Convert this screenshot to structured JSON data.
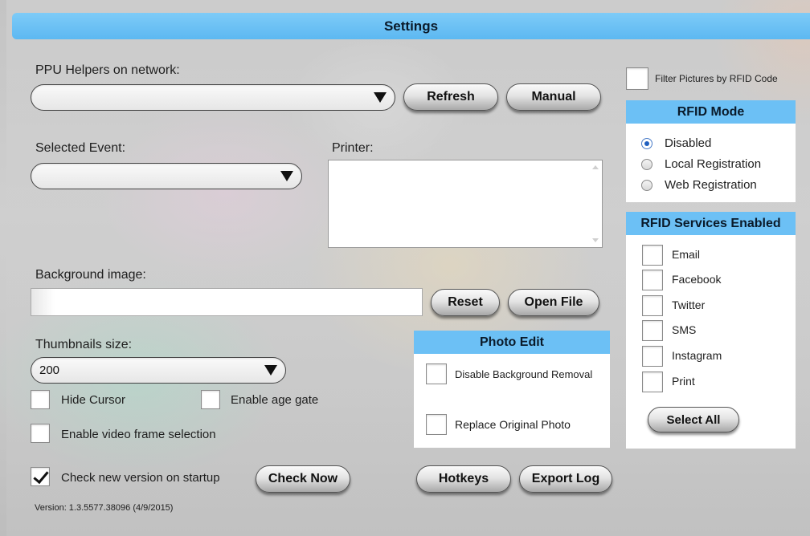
{
  "window": {
    "title": "Settings"
  },
  "ppu": {
    "label": "PPU Helpers on network:",
    "selected": "",
    "refresh_label": "Refresh",
    "manual_label": "Manual"
  },
  "event": {
    "label": "Selected Event:",
    "selected": ""
  },
  "printer": {
    "label": "Printer:",
    "items": []
  },
  "background": {
    "label": "Background image:",
    "value": "",
    "reset_label": "Reset",
    "open_label": "Open File"
  },
  "thumbnails": {
    "label": "Thumbnails size:",
    "selected": "200"
  },
  "options": {
    "hide_cursor": {
      "label": "Hide Cursor",
      "checked": false
    },
    "age_gate": {
      "label": "Enable age gate",
      "checked": false
    },
    "video_frame": {
      "label": "Enable video frame selection",
      "checked": false
    },
    "check_version": {
      "label": "Check new version on startup",
      "checked": true
    },
    "check_now_label": "Check Now"
  },
  "photo_edit": {
    "title": "Photo Edit",
    "disable_bg_removal": {
      "label": "Disable Background Removal",
      "checked": false
    },
    "replace_original": {
      "label": "Replace Original Photo",
      "checked": false
    }
  },
  "footer": {
    "hotkeys_label": "Hotkeys",
    "export_log_label": "Export Log",
    "version": "Version: 1.3.5577.38096 (4/9/2015)"
  },
  "filter": {
    "label": "Filter Pictures by RFID Code",
    "checked": false
  },
  "rfid_mode": {
    "title": "RFID Mode",
    "options": [
      "Disabled",
      "Local Registration",
      "Web Registration"
    ],
    "selected": "Disabled"
  },
  "rfid_services": {
    "title": "RFID Services Enabled",
    "items": [
      "Email",
      "Facebook",
      "Twitter",
      "SMS",
      "Instagram",
      "Print"
    ],
    "select_all_label": "Select All"
  },
  "colors": {
    "accent": "#6cc0f5",
    "title_bar": "#5cb8f2",
    "check_mark": "#111111",
    "radio_on": "#1f5fbf"
  },
  "icons": [
    "dropdown-arrow-icon",
    "checkmark-icon",
    "radio-dot-icon"
  ]
}
